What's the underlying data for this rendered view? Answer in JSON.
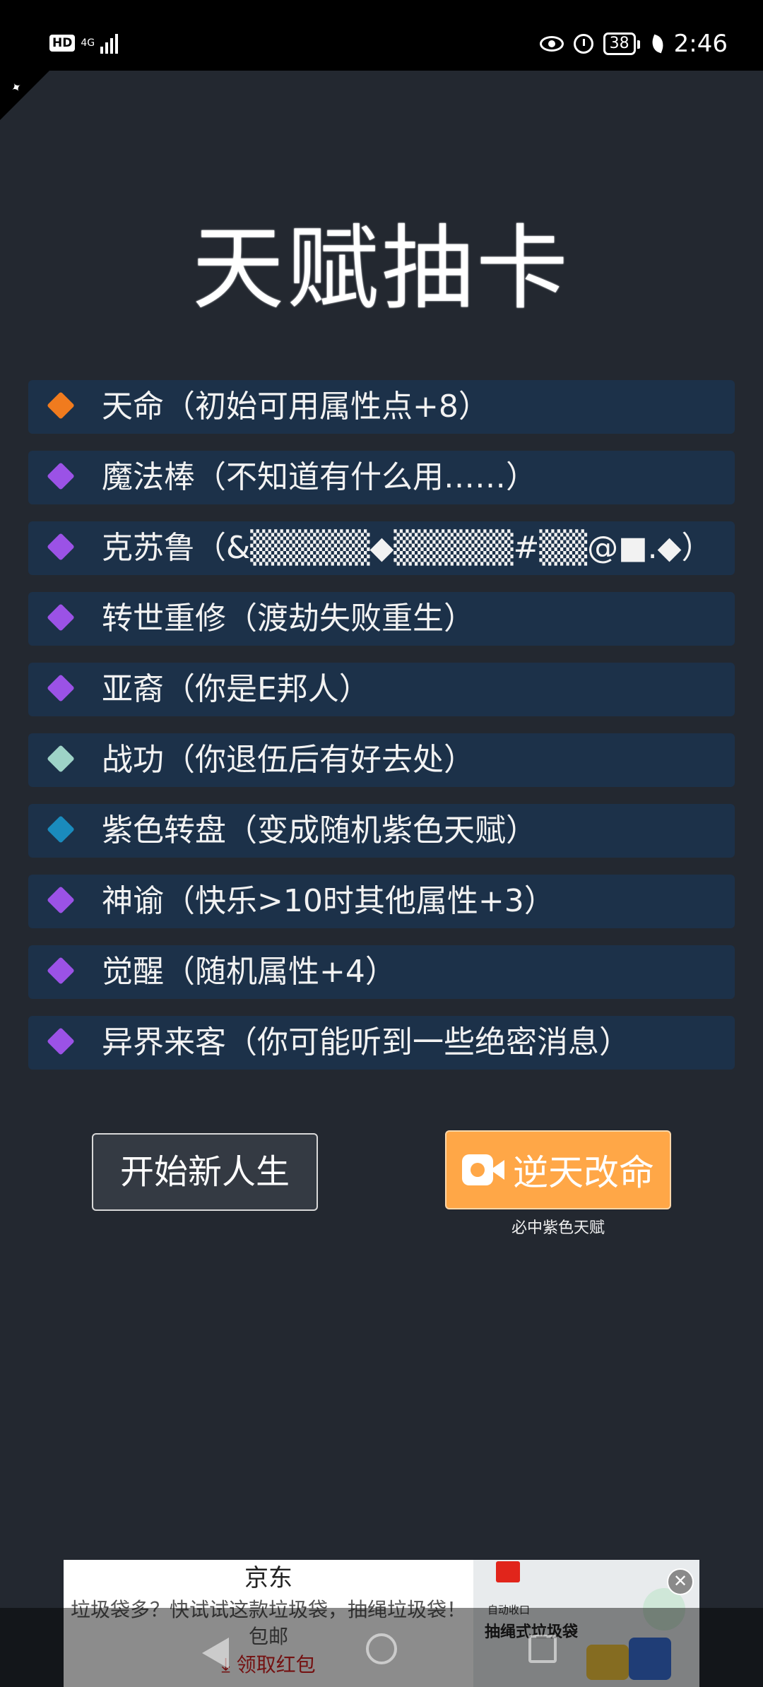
{
  "status_bar": {
    "hd": "HD",
    "network": "4G",
    "battery": "38",
    "time": "2:46"
  },
  "title": "天赋抽卡",
  "talents": [
    {
      "text": "天命（初始可用属性点+8）",
      "color": "#f07b1e"
    },
    {
      "text": "魔法棒（不知道有什么用……）",
      "color": "#9b52e6"
    },
    {
      "text": "克苏鲁（&▒▒▒▒▒◆▒▒▒▒▒#▒▒@■.◆）",
      "color": "#9b52e6"
    },
    {
      "text": "转世重修（渡劫失败重生）",
      "color": "#9b52e6"
    },
    {
      "text": "亚裔（你是E邦人）",
      "color": "#9b52e6"
    },
    {
      "text": "战功（你退伍后有好去处）",
      "color": "#9ed3c7"
    },
    {
      "text": "紫色转盘（变成随机紫色天赋）",
      "color": "#1a8bbd"
    },
    {
      "text": "神谕（快乐>10时其他属性+3）",
      "color": "#9b52e6"
    },
    {
      "text": "觉醒（随机属性+4）",
      "color": "#9b52e6"
    },
    {
      "text": "异界来客（你可能听到一些绝密消息）",
      "color": "#9b52e6"
    }
  ],
  "buttons": {
    "start_new_life": "开始新人生",
    "defy_fate": "逆天改命",
    "defy_fate_sub": "必中紫色天赋"
  },
  "ad": {
    "brand": "京东",
    "description": "垃圾袋多？快试试这款垃圾袋，抽绳垃圾袋！包邮",
    "cta": "⤓ 领取红包",
    "product_small": "自动收口",
    "product_title": "抽绳式垃圾袋"
  }
}
